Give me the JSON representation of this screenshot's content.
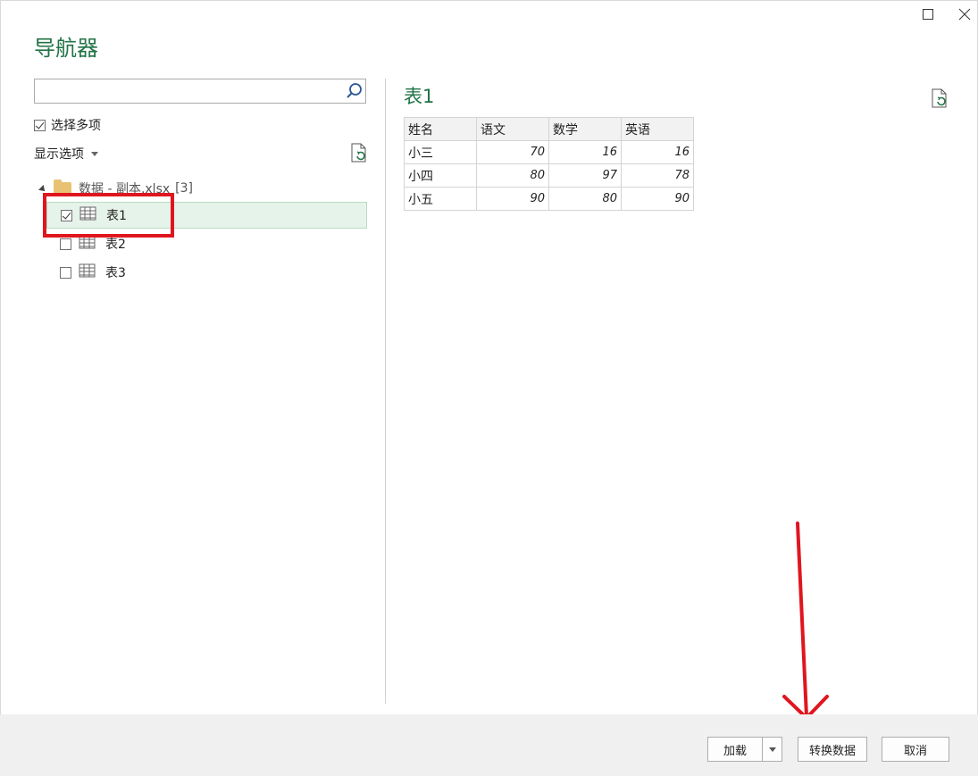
{
  "window": {
    "title": "导航器",
    "maximize_icon": "maximize-icon",
    "close_icon": "close-icon"
  },
  "left_panel": {
    "search": {
      "value": "",
      "placeholder": ""
    },
    "select_multiple": {
      "label": "选择多项",
      "checked": true
    },
    "display_options": {
      "label": "显示选项"
    },
    "tree": {
      "root": {
        "name": "数据 - 副本.xlsx",
        "count": "[3]"
      },
      "items": [
        {
          "label": "表1",
          "checked": true,
          "selected": true
        },
        {
          "label": "表2",
          "checked": false,
          "selected": false
        },
        {
          "label": "表3",
          "checked": false,
          "selected": false
        }
      ]
    }
  },
  "preview": {
    "title": "表1",
    "columns": [
      "姓名",
      "语文",
      "数学",
      "英语"
    ],
    "rows": [
      [
        "小三",
        "70",
        "16",
        "16"
      ],
      [
        "小四",
        "80",
        "97",
        "78"
      ],
      [
        "小五",
        "90",
        "80",
        "90"
      ]
    ]
  },
  "footer": {
    "load_label": "加载",
    "transform_label": "转换数据",
    "cancel_label": "取消"
  },
  "colors": {
    "accent": "#217346",
    "annotation": "#e0161f"
  }
}
